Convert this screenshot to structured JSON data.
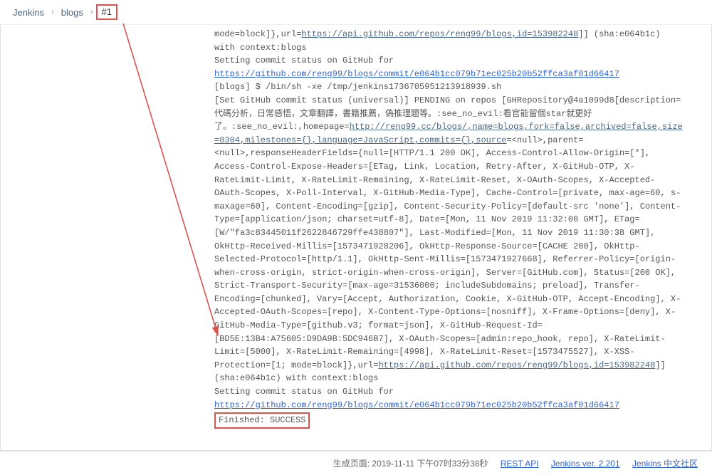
{
  "breadcrumbs": {
    "items": [
      "Jenkins",
      "blogs",
      "#1"
    ]
  },
  "console": {
    "line1a": "mode=block]},url=",
    "url1": "https://api.github.com/repos/reng99/blogs,id=153982248",
    "line1b": "]] (sha:e064b1c) with context:blogs",
    "line2": "Setting commit status on GitHub for",
    "url2": "https://github.com/reng99/blogs/commit/e064b1cc079b71ec025b20b52ffca3af01d66417",
    "line3": "[blogs] $ /bin/sh -xe /tmp/jenkins1736705951213918939.sh",
    "line4": "[Set GitHub commit status (universal)] PENDING on repos [GHRepository@4a1099d8[description=代碼分析，日常感悟，文章翻譯，書籍推薦，偽推理題等。:see_no_evil:看官能留個star就更好了。:see_no_evil:,homepage=",
    "url3": "http://reng99.cc/blogs/,name=blogs,fork=false,archived=false,size=8304,milestones={},language=JavaScript,commits={},source",
    "line5": "=<null>,parent=<null>,responseHeaderFields={null=[HTTP/1.1 200 OK], Access-Control-Allow-Origin=[*], Access-Control-Expose-Headers=[ETag, Link, Location, Retry-After, X-GitHub-OTP, X-RateLimit-Limit, X-RateLimit-Remaining, X-RateLimit-Reset, X-OAuth-Scopes, X-Accepted-OAuth-Scopes, X-Poll-Interval, X-GitHub-Media-Type], Cache-Control=[private, max-age=60, s-maxage=60], Content-Encoding=[gzip], Content-Security-Policy=[default-src 'none'], Content-Type=[application/json; charset=utf-8], Date=[Mon, 11 Nov 2019 11:32:08 GMT], ETag=[W/\"fa3c83445011f2622846729ffe438807\"], Last-Modified=[Mon, 11 Nov 2019 11:30:38 GMT], OkHttp-Received-Millis=[1573471928206], OkHttp-Response-Source=[CACHE 200], OkHttp-Selected-Protocol=[http/1.1], OkHttp-Sent-Millis=[1573471927668], Referrer-Policy=[origin-when-cross-origin, strict-origin-when-cross-origin], Server=[GitHub.com], Status=[200 OK], Strict-Transport-Security=[max-age=31536000; includeSubdomains; preload], Transfer-Encoding=[chunked], Vary=[Accept, Authorization, Cookie, X-GitHub-OTP, Accept-Encoding], X-Accepted-OAuth-Scopes=[repo], X-Content-Type-Options=[nosniff], X-Frame-Options=[deny], X-GitHub-Media-Type=[github.v3; format=json], X-GitHub-Request-Id=[BD5E:13B4:A75605:D9DA9B:5DC946B7], X-OAuth-Scopes=[admin:repo_hook, repo], X-RateLimit-Limit=[5000], X-RateLimit-Remaining=[4998], X-RateLimit-Reset=[1573475527], X-XSS-Protection=[1; mode=block]},url=",
    "url4": "https://api.github.com/repos/reng99/blogs,id=153982248",
    "line6": "]] (sha:e064b1c) with context:blogs",
    "line7": "Setting commit status on GitHub for",
    "url5": "https://github.com/reng99/blogs/commit/e064b1cc079b71ec025b20b52ffca3af01d66417",
    "finished": "Finished: SUCCESS"
  },
  "footer": {
    "gen_label": "生成页面:",
    "gen_time": "2019-11-11 下午07时33分38秒",
    "rest_api": "REST API",
    "version": "Jenkins ver. 2.201",
    "cn_community": "Jenkins 中文社区"
  }
}
